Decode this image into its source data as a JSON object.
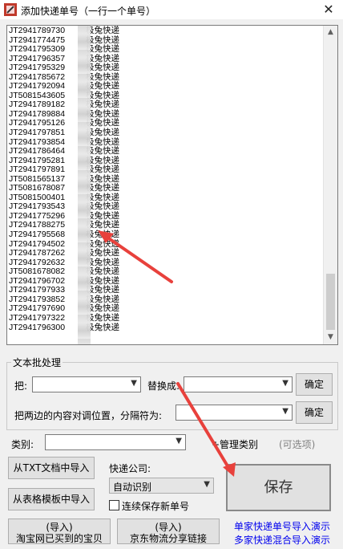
{
  "window": {
    "title": "添加快递单号（一行一个单号）",
    "icon": "app-icon",
    "close_icon": "close-icon"
  },
  "tracking_list": [
    {
      "no": "JT2941789730",
      "carrier": "极兔快递"
    },
    {
      "no": "JT2941774475",
      "carrier": "极兔快递"
    },
    {
      "no": "JT2941795309",
      "carrier": "极兔快递"
    },
    {
      "no": "JT2941796357",
      "carrier": "极兔快递"
    },
    {
      "no": "JT2941795329",
      "carrier": "极兔快递"
    },
    {
      "no": "JT2941785672",
      "carrier": "极兔快递"
    },
    {
      "no": "JT2941792094",
      "carrier": "极兔快递"
    },
    {
      "no": "JT5081543605",
      "carrier": "极兔快递"
    },
    {
      "no": "JT2941789182",
      "carrier": "极兔快递"
    },
    {
      "no": "JT2941789884",
      "carrier": "极兔快递"
    },
    {
      "no": "JT2941795126",
      "carrier": "极兔快递"
    },
    {
      "no": "JT2941797851",
      "carrier": "极兔快递"
    },
    {
      "no": "JT2941793854",
      "carrier": "极兔快递"
    },
    {
      "no": "JT2941786464",
      "carrier": "极兔快递"
    },
    {
      "no": "JT2941795281",
      "carrier": "极兔快递"
    },
    {
      "no": "JT2941797891",
      "carrier": "极兔快递"
    },
    {
      "no": "JT5081565137",
      "carrier": "极兔快递"
    },
    {
      "no": "JT5081678087",
      "carrier": "极兔快递"
    },
    {
      "no": "JT5081500401",
      "carrier": "极兔快递"
    },
    {
      "no": "JT2941793543",
      "carrier": "极兔快递"
    },
    {
      "no": "JT2941775296",
      "carrier": "极兔快递"
    },
    {
      "no": "JT2941788275",
      "carrier": "极兔快递"
    },
    {
      "no": "JT2941795568",
      "carrier": "极兔快递"
    },
    {
      "no": "JT2941794502",
      "carrier": "极兔快递"
    },
    {
      "no": "JT2941787262",
      "carrier": "极兔快递"
    },
    {
      "no": "JT2941792632",
      "carrier": "极兔快递"
    },
    {
      "no": "JT5081678082",
      "carrier": "极兔快递"
    },
    {
      "no": "JT2941796702",
      "carrier": "极兔快递"
    },
    {
      "no": "JT2941797933",
      "carrier": "极兔快递"
    },
    {
      "no": "JT2941793852",
      "carrier": "极兔快递"
    },
    {
      "no": "JT2941797690",
      "carrier": "极兔快递"
    },
    {
      "no": "JT2941797322",
      "carrier": "极兔快递"
    },
    {
      "no": "JT2941796300",
      "carrier": "极兔快递"
    }
  ],
  "batch": {
    "group_title": "文本批处理",
    "find_label": "把:",
    "replace_label": "替换成:",
    "confirm_label": "确定",
    "swap_label": "把两边的内容对调位置，分隔符为:",
    "swap_confirm_label": "确定"
  },
  "category": {
    "label": "类别:",
    "manage_label": "+管理类别",
    "optional_hint": "(可选项)"
  },
  "import": {
    "from_txt": "从TXT文档中导入",
    "from_table": "从表格模板中导入",
    "taobao_line1": "(导入)",
    "taobao_line2": "淘宝网已买到的宝贝",
    "jd_line1": "(导入)",
    "jd_line2": "京东物流分享链接"
  },
  "courier": {
    "label": "快递公司:",
    "selected": "自动识别",
    "continuous_save_label": "连续保存新单号"
  },
  "save_label": "保存",
  "links": {
    "single_demo": "单家快递单号导入演示",
    "mixed_demo": "多家快递混合导入演示"
  },
  "annotation_color": "#e8413c"
}
